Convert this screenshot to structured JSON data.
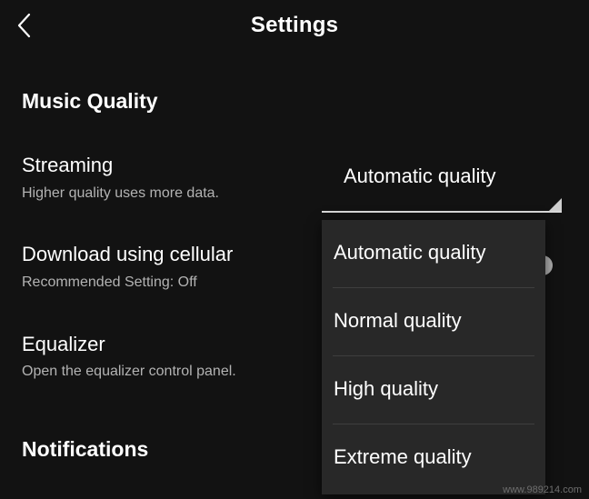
{
  "header": {
    "title": "Settings",
    "back_icon": "chevron-left-icon"
  },
  "sections": {
    "music_quality": "Music Quality",
    "notifications": "Notifications"
  },
  "settings": {
    "streaming": {
      "title": "Streaming",
      "description": "Higher quality uses more data."
    },
    "cellular": {
      "title": "Download using cellular",
      "description": "Recommended Setting: Off"
    },
    "equalizer": {
      "title": "Equalizer",
      "description": "Open the equalizer control panel."
    }
  },
  "streaming_select": {
    "selected": "Automatic quality",
    "options": [
      "Automatic quality",
      "Normal quality",
      "High quality",
      "Extreme quality"
    ]
  },
  "colors": {
    "background": "#121212",
    "dropdown": "#282828",
    "secondary_text": "#b3b3b3"
  },
  "watermark": "www.989214.com"
}
